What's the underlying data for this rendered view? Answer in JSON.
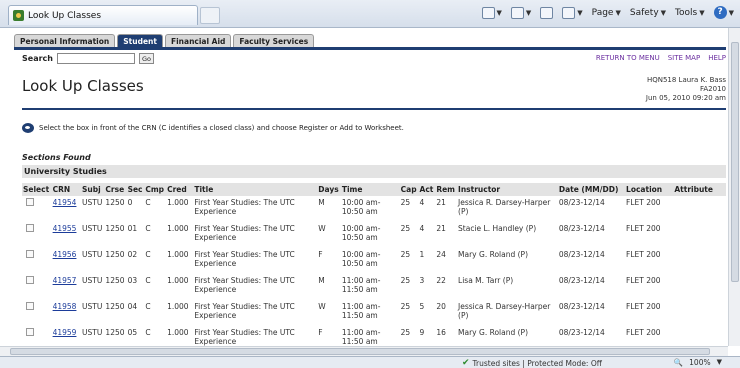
{
  "browser": {
    "tab_title": "Look Up Classes",
    "commands": [
      "Page",
      "Safety",
      "Tools"
    ]
  },
  "banner_tabs": [
    {
      "label": "Personal Information",
      "active": false
    },
    {
      "label": "Student",
      "active": true
    },
    {
      "label": "Financial Aid",
      "active": false
    },
    {
      "label": "Faculty Services",
      "active": false
    }
  ],
  "search": {
    "label": "Search",
    "value": "",
    "go_label": "Go"
  },
  "top_links": [
    "RETURN TO MENU",
    "SITE MAP",
    "HELP"
  ],
  "page_title": "Look Up Classes",
  "user_info": {
    "line1": "HQN518 Laura K. Bass",
    "line2": "FA2010",
    "line3": "Jun 05, 2010 09:20 am"
  },
  "info_text": "Select the box in front of the CRN (C identifies a closed class) and choose Register or Add to Worksheet.",
  "sections_found": "Sections Found",
  "section_header": "University Studies",
  "columns": [
    "Select",
    "CRN",
    "Subj",
    "Crse",
    "Sec",
    "Cmp",
    "Cred",
    "Title",
    "Days",
    "Time",
    "Cap",
    "Act",
    "Rem",
    "Instructor",
    "Date (MM/DD)",
    "Location",
    "Attribute"
  ],
  "rows": [
    {
      "crn": "41954",
      "subj": "USTU",
      "crse": "1250",
      "sec": "0",
      "cmp": "C",
      "cred": "1.000",
      "title": "First Year Studies: The UTC Experience",
      "days": "M",
      "time": "10:00 am-10:50 am",
      "cap": "25",
      "act": "4",
      "rem": "21",
      "instructor": "Jessica R. Darsey-Harper (P)",
      "date": "08/23-12/14",
      "location": "FLET 200",
      "attribute": ""
    },
    {
      "crn": "41955",
      "subj": "USTU",
      "crse": "1250",
      "sec": "01",
      "cmp": "C",
      "cred": "1.000",
      "title": "First Year Studies: The UTC Experience",
      "days": "W",
      "time": "10:00 am-10:50 am",
      "cap": "25",
      "act": "4",
      "rem": "21",
      "instructor": "Stacie L. Handley (P)",
      "date": "08/23-12/14",
      "location": "FLET 200",
      "attribute": ""
    },
    {
      "crn": "41956",
      "subj": "USTU",
      "crse": "1250",
      "sec": "02",
      "cmp": "C",
      "cred": "1.000",
      "title": "First Year Studies: The UTC Experience",
      "days": "F",
      "time": "10:00 am-10:50 am",
      "cap": "25",
      "act": "1",
      "rem": "24",
      "instructor": "Mary G. Roland (P)",
      "date": "08/23-12/14",
      "location": "FLET 200",
      "attribute": ""
    },
    {
      "crn": "41957",
      "subj": "USTU",
      "crse": "1250",
      "sec": "03",
      "cmp": "C",
      "cred": "1.000",
      "title": "First Year Studies: The UTC Experience",
      "days": "M",
      "time": "11:00 am-11:50 am",
      "cap": "25",
      "act": "3",
      "rem": "22",
      "instructor": "Lisa M. Tarr (P)",
      "date": "08/23-12/14",
      "location": "FLET 200",
      "attribute": ""
    },
    {
      "crn": "41958",
      "subj": "USTU",
      "crse": "1250",
      "sec": "04",
      "cmp": "C",
      "cred": "1.000",
      "title": "First Year Studies: The UTC Experience",
      "days": "W",
      "time": "11:00 am-11:50 am",
      "cap": "25",
      "act": "5",
      "rem": "20",
      "instructor": "Jessica R. Darsey-Harper (P)",
      "date": "08/23-12/14",
      "location": "FLET 200",
      "attribute": ""
    },
    {
      "crn": "41959",
      "subj": "USTU",
      "crse": "1250",
      "sec": "05",
      "cmp": "C",
      "cred": "1.000",
      "title": "First Year Studies: The UTC Experience",
      "days": "F",
      "time": "11:00 am-11:50 am",
      "cap": "25",
      "act": "9",
      "rem": "16",
      "instructor": "Mary G. Roland (P)",
      "date": "08/23-12/14",
      "location": "FLET 200",
      "attribute": ""
    }
  ],
  "status": {
    "zone": "Trusted sites | Protected Mode: Off",
    "zoom": "100%"
  }
}
